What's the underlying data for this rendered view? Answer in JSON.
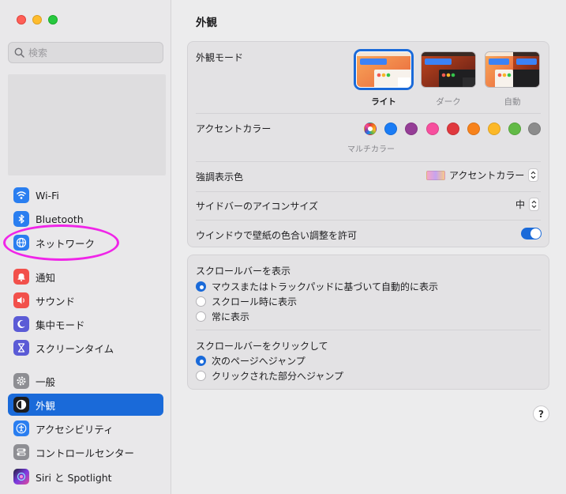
{
  "sidebar": {
    "search_placeholder": "検索",
    "items": [
      {
        "label": "Wi-Fi",
        "icon": "wifi-icon",
        "color": "#2a7ef0"
      },
      {
        "label": "Bluetooth",
        "icon": "bluetooth-icon",
        "color": "#2a7ef0"
      },
      {
        "label": "ネットワーク",
        "icon": "globe-icon",
        "color": "#2a7ef0"
      },
      {
        "label": "通知",
        "icon": "bell-icon",
        "color": "#f2504b"
      },
      {
        "label": "サウンド",
        "icon": "speaker-icon",
        "color": "#f2504b"
      },
      {
        "label": "集中モード",
        "icon": "moon-icon",
        "color": "#5b5bd6"
      },
      {
        "label": "スクリーンタイム",
        "icon": "hourglass-icon",
        "color": "#5b5bd6"
      },
      {
        "label": "一般",
        "icon": "gear-icon",
        "color": "#8e8e93"
      },
      {
        "label": "外観",
        "icon": "appearance-icon",
        "color": "#1d1d1f"
      },
      {
        "label": "アクセシビリティ",
        "icon": "accessibility-icon",
        "color": "#2a7ef0"
      },
      {
        "label": "コントロールセンター",
        "icon": "control-center-icon",
        "color": "#8e8e93"
      },
      {
        "label": "Siri と Spotlight",
        "icon": "siri-icon",
        "color": "#7a3be0"
      }
    ],
    "selected": "外観"
  },
  "main": {
    "title": "外観",
    "appearance_mode": {
      "label": "外観モード",
      "options": [
        "ライト",
        "ダーク",
        "自動"
      ],
      "selected": "ライト"
    },
    "accent": {
      "label": "アクセントカラー",
      "colors": [
        "multicolor",
        "#1a7cf5",
        "#953d96",
        "#f74f9e",
        "#e0383e",
        "#f7821b",
        "#fcb827",
        "#62ba46",
        "#8c8c8c"
      ],
      "caption": "マルチカラー"
    },
    "highlight": {
      "label": "強調表示色",
      "value": "アクセントカラー"
    },
    "sidebar_icon_size": {
      "label": "サイドバーのアイコンサイズ",
      "value": "中"
    },
    "wallpaper_tint": {
      "label": "ウインドウで壁紙の色合い調整を許可",
      "on": true
    },
    "scrollbar_show": {
      "label": "スクロールバーを表示",
      "options": [
        "マウスまたはトラックパッドに基づいて自動的に表示",
        "スクロール時に表示",
        "常に表示"
      ],
      "selected": 0
    },
    "scrollbar_click": {
      "label": "スクロールバーをクリックして",
      "options": [
        "次のページへジャンプ",
        "クリックされた部分へジャンプ"
      ],
      "selected": 0
    },
    "help_label": "?"
  }
}
